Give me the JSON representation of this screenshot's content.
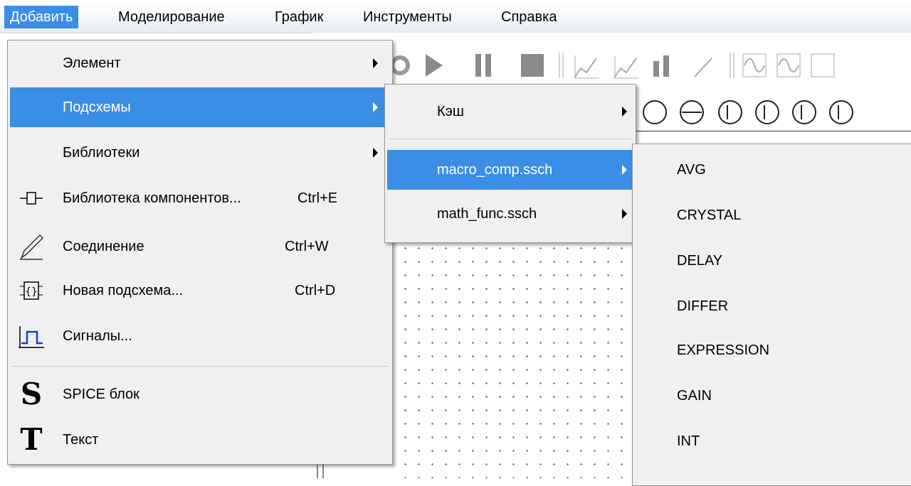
{
  "menubar": {
    "items": [
      "Добавить",
      "Моделирование",
      "График",
      "Инструменты",
      "Справка"
    ]
  },
  "menu_add": {
    "items": [
      {
        "label": "Элемент",
        "submenu": true
      },
      {
        "label": "Подсхемы",
        "submenu": true,
        "selected": true
      },
      {
        "label": "Библиотеки",
        "submenu": true
      },
      {
        "label": "Библиотека компонентов...",
        "shortcut": "Ctrl+E",
        "icon": "component-library-icon"
      },
      {
        "label": "Соединение",
        "shortcut": "Ctrl+W",
        "icon": "pencil-icon"
      },
      {
        "label": "Новая подсхема...",
        "shortcut": "Ctrl+D",
        "icon": "subcircuit-icon"
      },
      {
        "label": "Сигналы...",
        "icon": "signal-pulse-icon"
      },
      {
        "label": "SPICE блок",
        "icon": "spice-s-icon",
        "icon_text": "S"
      },
      {
        "label": "Текст",
        "icon": "text-t-icon",
        "icon_text": "T"
      }
    ]
  },
  "menu_subcircuits": {
    "items": [
      {
        "label": "Кэш",
        "submenu": true
      },
      {
        "label": "macro_comp.ssch",
        "submenu": true,
        "selected": true
      },
      {
        "label": "math_func.ssch",
        "submenu": true
      }
    ]
  },
  "menu_macro": {
    "items": [
      "AVG",
      "CRYSTAL",
      "DELAY",
      "DIFFER",
      "EXPRESSION",
      "GAIN",
      "INT"
    ]
  },
  "colors": {
    "selection": "#3a8ee6",
    "menu_bg": "#f0f0f0"
  }
}
